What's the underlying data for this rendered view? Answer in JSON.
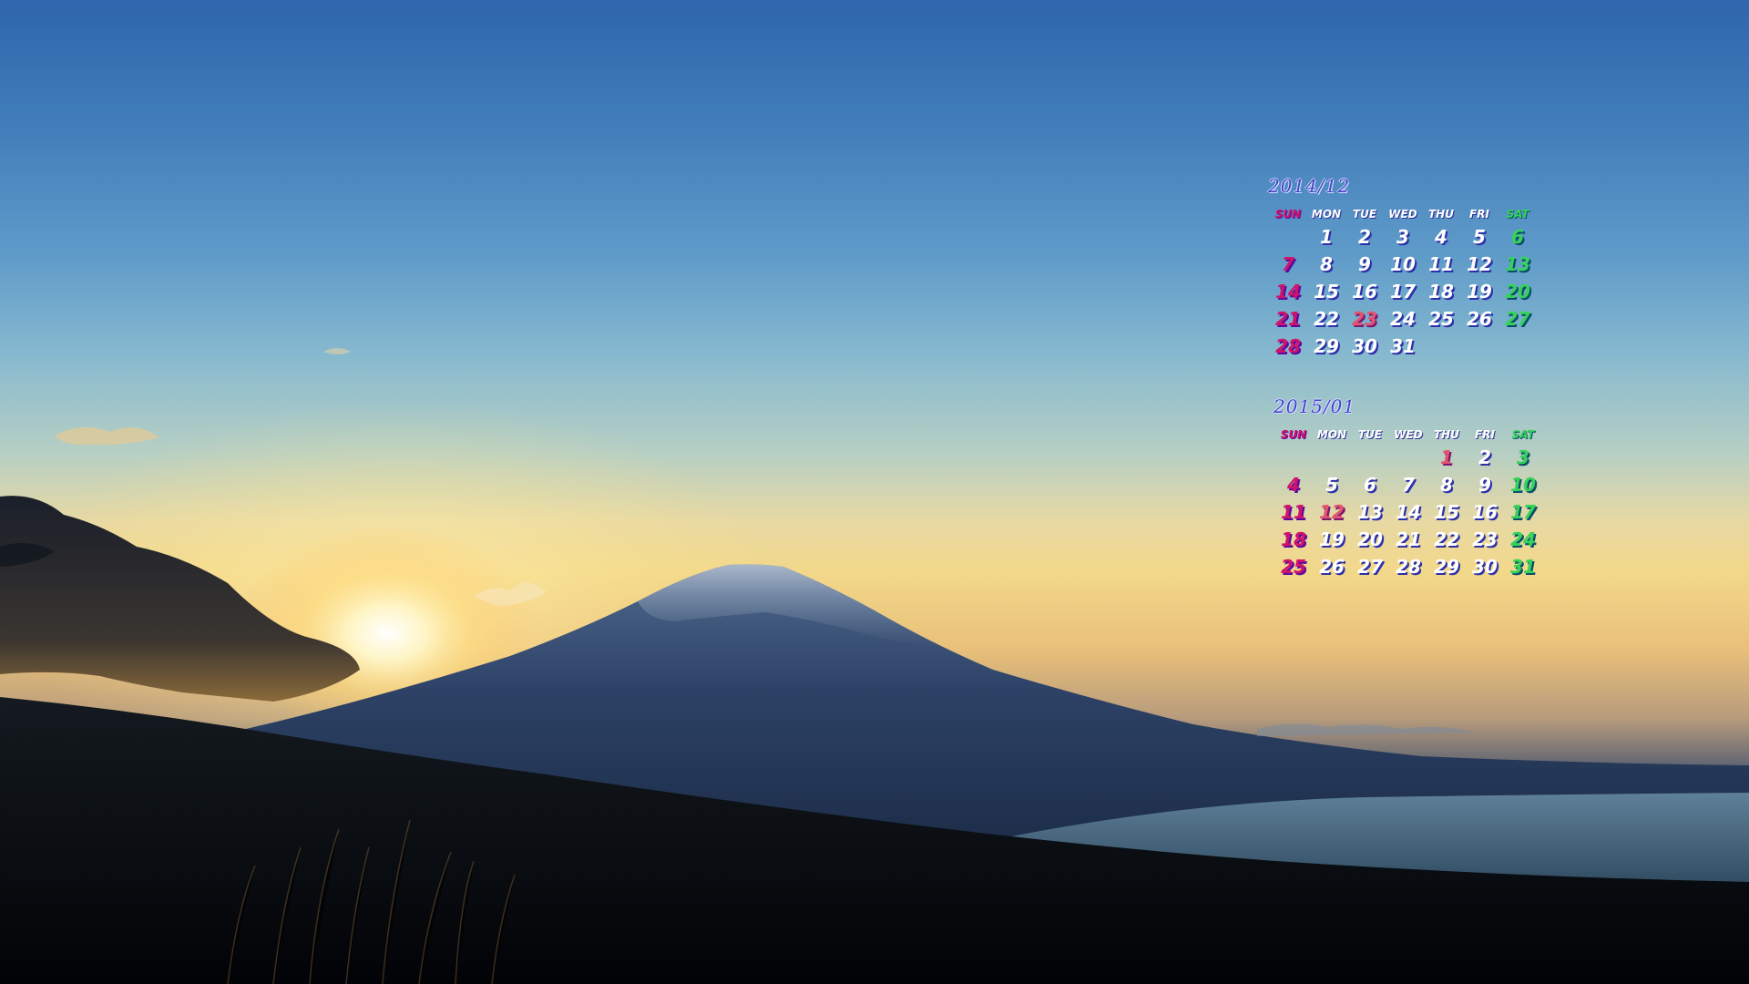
{
  "scene": {
    "subject": "mountain-sunset-landscape",
    "sky_top_color": "#2f66ad",
    "sun_color": "#fff8dc",
    "mountain_color": "#2a3b5a",
    "lake_color": "#4c6f8a"
  },
  "colors": {
    "sunday": "#d0126a",
    "saturday": "#35d35a",
    "holiday": "#e3546e",
    "weekday": "#ffffff",
    "title": "#3f46c8"
  },
  "calendars": [
    {
      "title": "2014/12",
      "weekdays": [
        "SUN",
        "MON",
        "TUE",
        "WED",
        "THU",
        "FRI",
        "SAT"
      ],
      "first_weekday": 1,
      "days_in_month": 31,
      "holidays": [
        23
      ]
    },
    {
      "title": "2015/01",
      "weekdays": [
        "SUN",
        "MON",
        "TUE",
        "WED",
        "THU",
        "FRI",
        "SAT"
      ],
      "first_weekday": 4,
      "days_in_month": 31,
      "holidays": [
        1,
        12
      ]
    }
  ]
}
